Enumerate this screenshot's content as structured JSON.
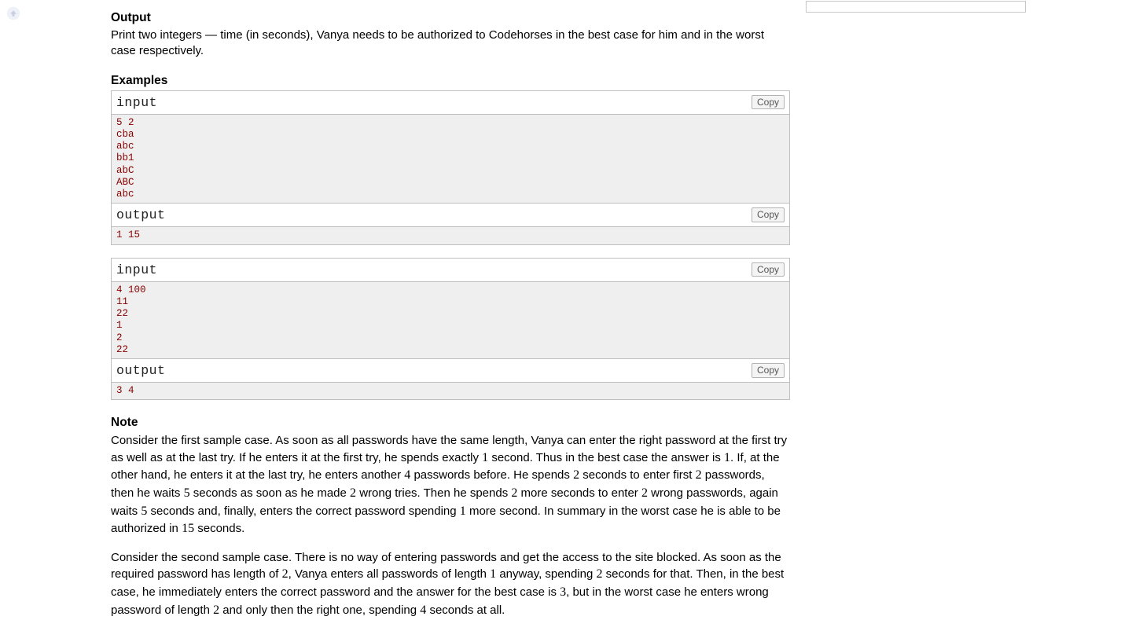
{
  "scroll_icon_name": "arrow-up-icon",
  "output": {
    "title": "Output",
    "text": "Print two integers — time (in seconds), Vanya needs to be authorized to Codehorses in the best case for him and in the worst case respectively."
  },
  "examples": {
    "title": "Examples",
    "labels": {
      "input": "input",
      "output": "output",
      "copy": "Copy"
    },
    "samples": [
      {
        "input": "5 2\ncba\nabc\nbb1\nabC\nABC\nabc",
        "output": "1 15"
      },
      {
        "input": "4 100\n11\n22\n1\n2\n22",
        "output": "3 4"
      }
    ]
  },
  "note": {
    "title": "Note",
    "p1": {
      "a": "Consider the first sample case. As soon as all passwords have the same length, Vanya can enter the right password at the first try as well as at the last try. If he enters it at the first try, he spends exactly ",
      "n1": "1",
      "b": " second. Thus in the best case the answer is ",
      "n2": "1",
      "c": ". If, at the other hand, he enters it at the last try, he enters another ",
      "n3": "4",
      "d": " passwords before. He spends ",
      "n4": "2",
      "e": " seconds to enter first ",
      "n5": "2",
      "f": " passwords, then he waits ",
      "n6": "5",
      "g": " seconds as soon as he made ",
      "n7": "2",
      "h": " wrong tries. Then he spends ",
      "n8": "2",
      "i": " more seconds to enter ",
      "n9": "2",
      "j": " wrong passwords, again waits ",
      "n10": "5",
      "k": " seconds and, finally, enters the correct password spending ",
      "n11": "1",
      "l": " more second. In summary in the worst case he is able to be authorized in ",
      "n12": "15",
      "m": " seconds."
    },
    "p2": {
      "a": "Consider the second sample case. There is no way of entering passwords and get the access to the site blocked. As soon as the required password has length of ",
      "n1": "2",
      "b": ", Vanya enters all passwords of length ",
      "n2": "1",
      "c": " anyway, spending ",
      "n3": "2",
      "d": " seconds for that. Then, in the best case, he immediately enters the correct password and the answer for the best case is ",
      "n4": "3",
      "e": ", but in the worst case he enters wrong password of length ",
      "n5": "2",
      "f": " and only then the right one, spending ",
      "n6": "4",
      "g": " seconds at all."
    }
  }
}
